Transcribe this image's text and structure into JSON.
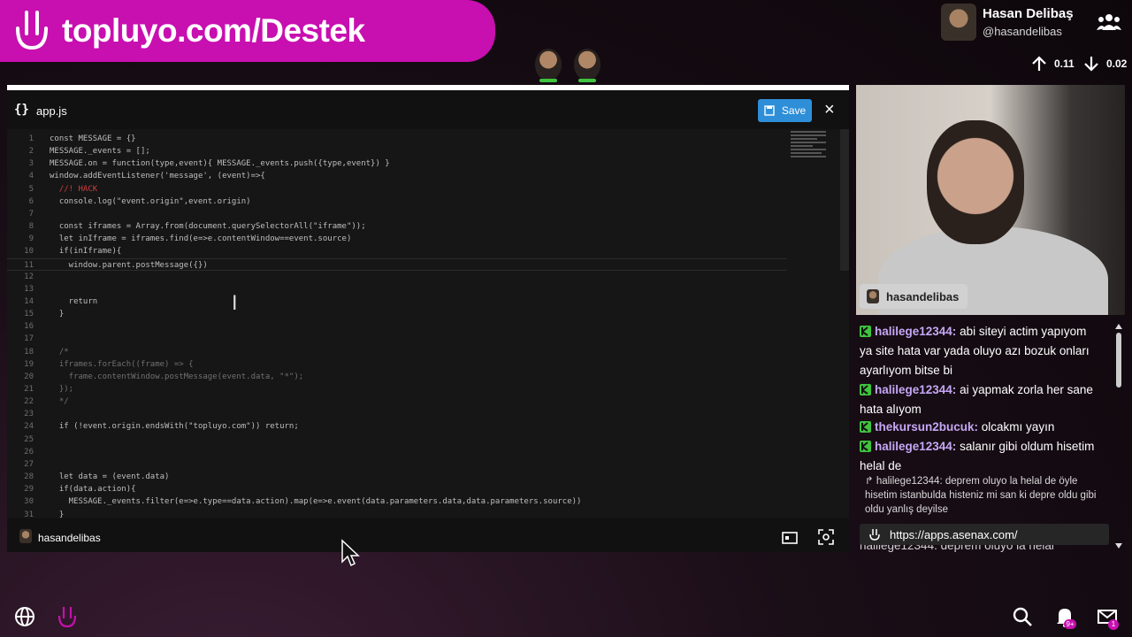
{
  "banner": {
    "url": "topluyo.com/Destek",
    "logo_icon": "topluyo-smile-icon"
  },
  "profile": {
    "name": "Hasan Delibaş",
    "handle": "@hasandelibas"
  },
  "network": {
    "up": "0.11",
    "down": "0.02"
  },
  "editor": {
    "filename": "app.js",
    "save_label": "Save",
    "lines": [
      {
        "n": "1",
        "text": "const MESSAGE = {}"
      },
      {
        "n": "2",
        "text": "MESSAGE._events = [];"
      },
      {
        "n": "3",
        "text": "MESSAGE.on = function(type,event){ MESSAGE._events.push({type,event}) }"
      },
      {
        "n": "4",
        "text": "window.addEventListener('message', (event)=>{"
      },
      {
        "n": "5",
        "text": "  //! HACK"
      },
      {
        "n": "6",
        "text": "  console.log(\"event.origin\",event.origin)"
      },
      {
        "n": "7",
        "text": ""
      },
      {
        "n": "8",
        "text": "  const iframes = Array.from(document.querySelectorAll(\"iframe\"));"
      },
      {
        "n": "9",
        "text": "  let inIframe = iframes.find(e=>e.contentWindow==event.source)"
      },
      {
        "n": "10",
        "text": "  if(inIframe){"
      },
      {
        "n": "11",
        "text": "    window.parent.postMessage({})"
      },
      {
        "n": "12",
        "text": ""
      },
      {
        "n": "13",
        "text": ""
      },
      {
        "n": "14",
        "text": "    return"
      },
      {
        "n": "15",
        "text": "  }"
      },
      {
        "n": "16",
        "text": ""
      },
      {
        "n": "17",
        "text": ""
      },
      {
        "n": "18",
        "text": "  /*"
      },
      {
        "n": "19",
        "text": "  iframes.forEach((frame) => {"
      },
      {
        "n": "20",
        "text": "    frame.contentWindow.postMessage(event.data, \"*\");"
      },
      {
        "n": "21",
        "text": "  });"
      },
      {
        "n": "22",
        "text": "  */"
      },
      {
        "n": "23",
        "text": ""
      },
      {
        "n": "24",
        "text": "  if (!event.origin.endsWith(\"topluyo.com\")) return;"
      },
      {
        "n": "25",
        "text": ""
      },
      {
        "n": "26",
        "text": ""
      },
      {
        "n": "27",
        "text": ""
      },
      {
        "n": "28",
        "text": "  let data = (event.data)"
      },
      {
        "n": "29",
        "text": "  if(data.action){"
      },
      {
        "n": "30",
        "text": "    MESSAGE._events.filter(e=>e.type==data.action).map(e=>e.event(data.parameters.data,data.parameters.source))"
      },
      {
        "n": "31",
        "text": "  }"
      }
    ],
    "footer_user": "hasandelibas"
  },
  "camera": {
    "tag": "hasandelibas"
  },
  "chat": {
    "messages": [
      {
        "user": "halilege12344:",
        "text": "abi siteyi actim yapıyom ya site hata var yada oluyo azı bozuk onları ayarlıyom bitse bi"
      },
      {
        "user": "halilege12344:",
        "text": "ai yapmak zorla her sane hata alıyom"
      },
      {
        "user": "thekursun2bucuk:",
        "text": "olcakmı yayın"
      },
      {
        "user": "halilege12344:",
        "text": "salanır gibi oldum hisetim helal de"
      }
    ],
    "reply": "↱ halilege12344: deprem oluyo la helal de öyle hisetim istanbulda histeniz mi san ki depre oldu gibi oldu yanlış deyilse",
    "link": "https://apps.asenax.com/",
    "partial": "halilege12344: deprem oluyo la helal"
  },
  "bottom": {
    "notif_count": "9+",
    "mail_count": "1"
  },
  "colors": {
    "brand": "#c80fb0",
    "save": "#2e8fd8",
    "username": "#c6a7f5"
  }
}
